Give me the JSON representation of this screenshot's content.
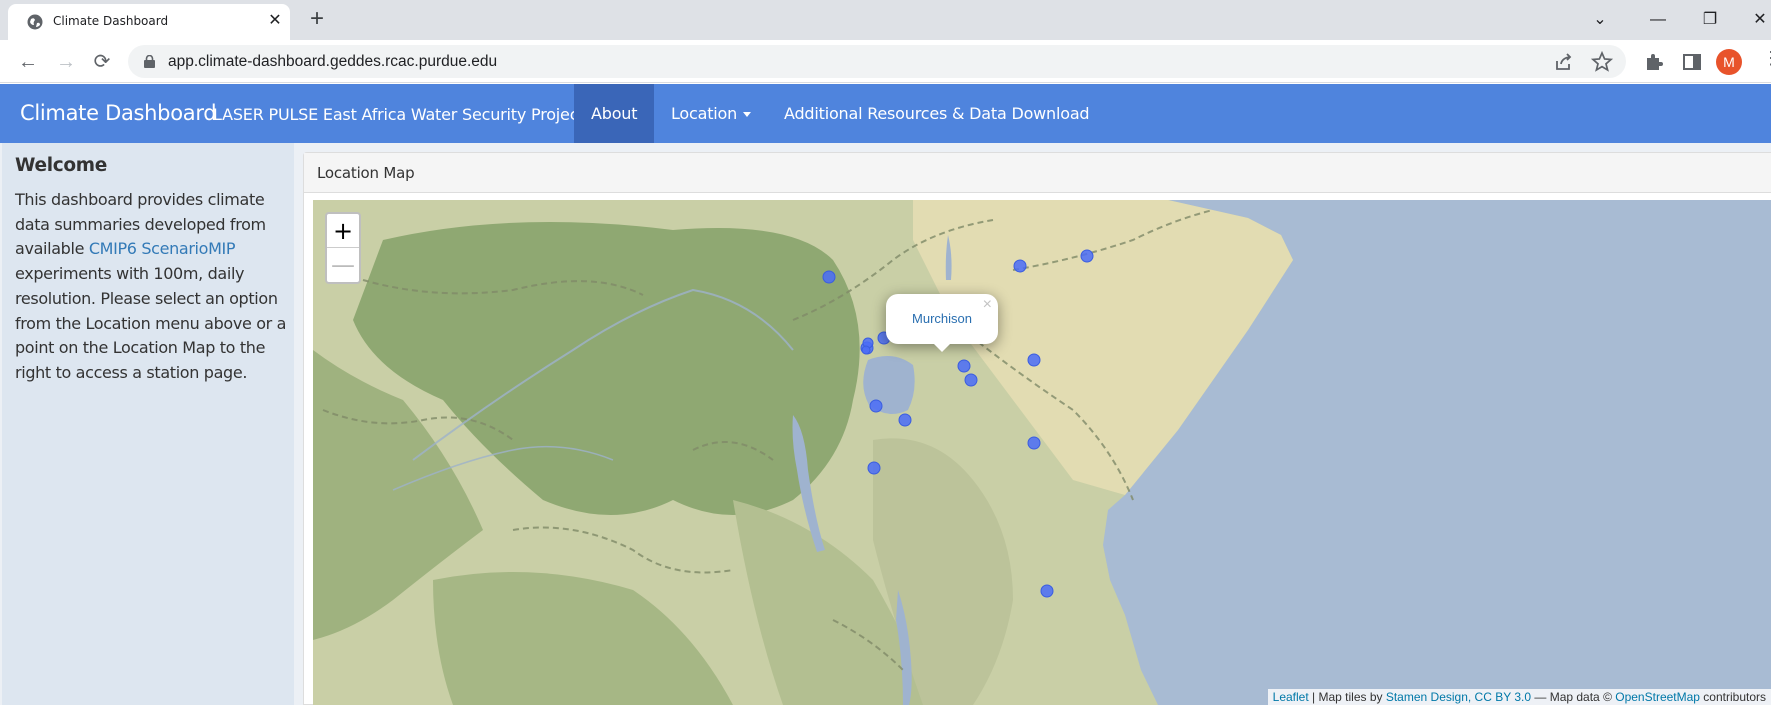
{
  "browser": {
    "tab_title": "Climate Dashboard",
    "tab_close": "✕",
    "new_tab": "+",
    "url": "app.climate-dashboard.geddes.rcac.purdue.edu",
    "avatar_letter": "M",
    "window_controls": {
      "dropdown": "⌄",
      "minimize": "—",
      "restore": "❐",
      "close": "✕"
    }
  },
  "navbar": {
    "brand": "Climate Dashboard",
    "subtitle": "LASER PULSE East Africa Water Security Project",
    "items": [
      {
        "label": "About",
        "active": true
      },
      {
        "label": "Location",
        "dropdown": true
      },
      {
        "label": "Additional Resources & Data Download"
      }
    ],
    "color": "#4f84dd",
    "active_color": "#3a66b8"
  },
  "sidebar": {
    "heading": "Welcome",
    "text_before_link": "This dashboard provides climate data summaries developed from available ",
    "link_text": "CMIP6 ScenarioMIP",
    "text_after_link": " experiments with 100m, daily resolution. Please select an option from the Location menu above or a point on the Location Map to the right to access a station page."
  },
  "panel": {
    "title": "Location Map"
  },
  "map": {
    "zoom_in": "+",
    "zoom_out": "—",
    "popup_label": "Murchison",
    "popup_close": "×",
    "station_count": 15,
    "marker_color": "#4a6cf7",
    "attribution": {
      "leaflet": "Leaflet",
      "sep1": " | Map tiles by ",
      "stamen": "Stamen Design, CC BY 3.0",
      "sep2": " — Map data © ",
      "osm": "OpenStreetMap",
      "tail": " contributors"
    }
  }
}
